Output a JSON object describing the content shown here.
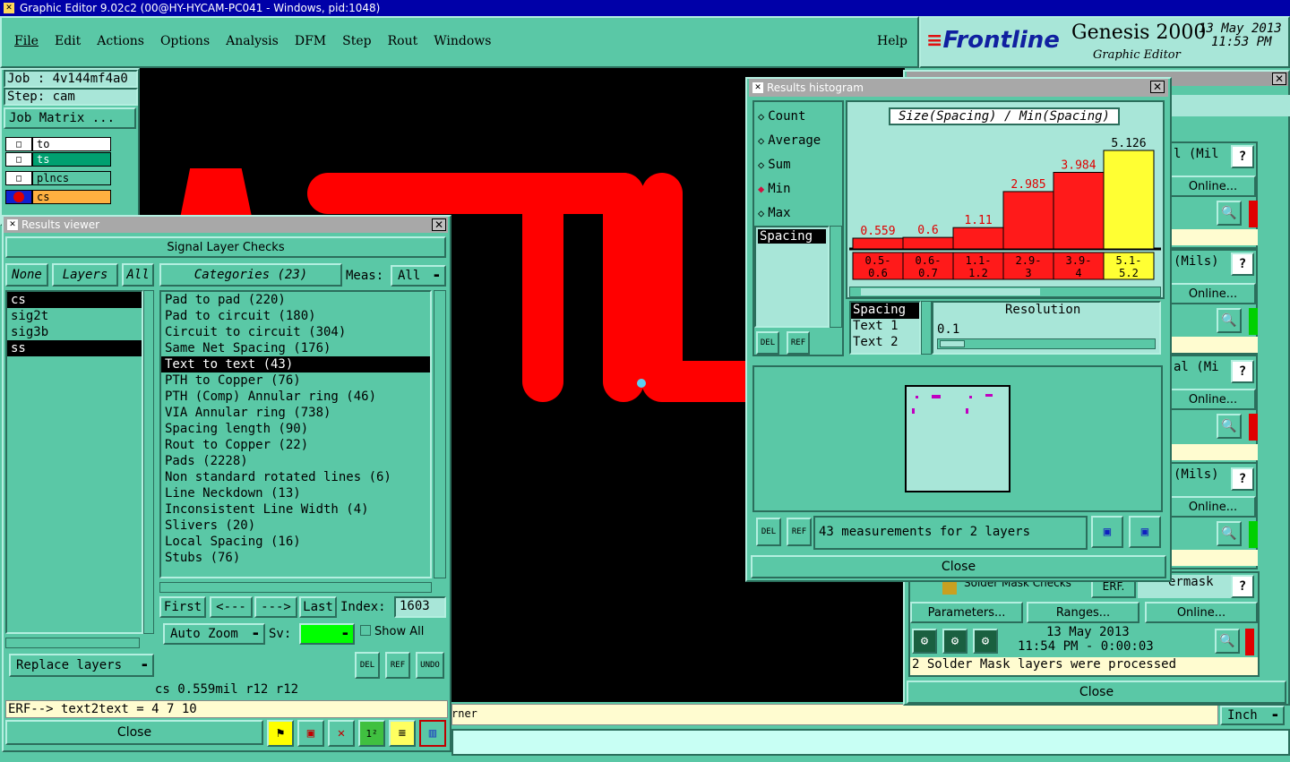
{
  "main_title": "Graphic Editor 9.02c2 (00@HY-HYCAM-PC041 - Windows, pid:1048)",
  "menu": [
    "File",
    "Edit",
    "Actions",
    "Options",
    "Analysis",
    "DFM",
    "Step",
    "Rout",
    "Windows"
  ],
  "help": "Help",
  "brand": {
    "name": "Frontline",
    "product": "Genesis 2000",
    "sub": "Graphic Editor",
    "date": "13 May 2013",
    "time": "11:53 PM"
  },
  "job": {
    "job": "Job : 4v144mf4a0",
    "step": "Step: cam",
    "matrix": "Job Matrix ..."
  },
  "layers": [
    "to",
    "ts",
    "plncs",
    "cs"
  ],
  "results_viewer": {
    "title": "Results viewer",
    "header": "Signal Layer Checks",
    "none": "None",
    "layers": "Layers",
    "all": "All",
    "categories_label": "Categories (23)",
    "meas_label": "Meas:",
    "meas_value": "All",
    "layer_list": [
      "cs",
      "sig2t",
      "sig3b",
      "ss"
    ],
    "categories": [
      "Pad to pad (220)",
      "Pad to circuit (180)",
      "Circuit to circuit (304)",
      "Same Net Spacing (176)",
      "Text to text (43)",
      "PTH to Copper (76)",
      "PTH (Comp) Annular ring (46)",
      "VIA Annular ring (738)",
      "Spacing length (90)",
      "Rout to Copper (22)",
      "Pads (2228)",
      "Non standard rotated lines (6)",
      "Line Neckdown (13)",
      "Inconsistent Line Width (4)",
      "Slivers (20)",
      "Local Spacing (16)",
      "Stubs (76)"
    ],
    "first": "First",
    "prev": "<---",
    "next": "--->",
    "last": "Last",
    "index_label": "Index:",
    "index_value": "1603",
    "auto_zoom": "Auto Zoom",
    "sv": "Sv:",
    "show_all": "Show All",
    "replace": "Replace layers",
    "status": "cs 0.559mil   r12   r12",
    "erf": "ERF--> text2text = 4 7 10",
    "close": "Close",
    "del": "DEL",
    "ref": "REF",
    "undo": "UNDO"
  },
  "histogram": {
    "title": "Results histogram",
    "modes": [
      "Count",
      "Average",
      "Sum",
      "Min",
      "Max"
    ],
    "chart_title": "Size(Spacing) / Min(Spacing)",
    "attr": "Spacing",
    "res_items": [
      "Spacing",
      "Text 1",
      "Text 2"
    ],
    "resolution": "Resolution",
    "res_value": "0.1",
    "measurements": "43 measurements for 2 layers",
    "close": "Close",
    "del": "DEL",
    "ref": "REF"
  },
  "chart_data": {
    "type": "bar",
    "title": "Size(Spacing) / Min(Spacing)",
    "categories": [
      "0.5-0.6",
      "0.6-0.7",
      "1.1-1.2",
      "2.9-3",
      "3.9-4",
      "5.1-5.2"
    ],
    "values": [
      0.559,
      0.6,
      1.11,
      2.985,
      3.984,
      5.126
    ],
    "value_labels": [
      "0.559",
      "0.6",
      "1.11",
      "2.985",
      "3.984",
      "5.126"
    ],
    "colors": [
      "#ff1a1a",
      "#ff1a1a",
      "#ff1a1a",
      "#ff1a1a",
      "#ff1a1a",
      "#ffff33"
    ]
  },
  "right_panel": {
    "labels": [
      "l (Mil",
      "(Mils)",
      "al (Mi",
      "(Mils)"
    ],
    "online": "Online...",
    "solder": "Solder Mask Checks",
    "erf_btn": "ERF.",
    "soldermask": "ermask",
    "parameters": "Parameters...",
    "ranges": "Ranges...",
    "date": "13 May 2013",
    "time": "11:54 PM - 0:00:03",
    "processed": "2 Solder Mask layers were processed",
    "close": "Close"
  },
  "bottom": {
    "corner": "rner",
    "unit": "Inch"
  }
}
